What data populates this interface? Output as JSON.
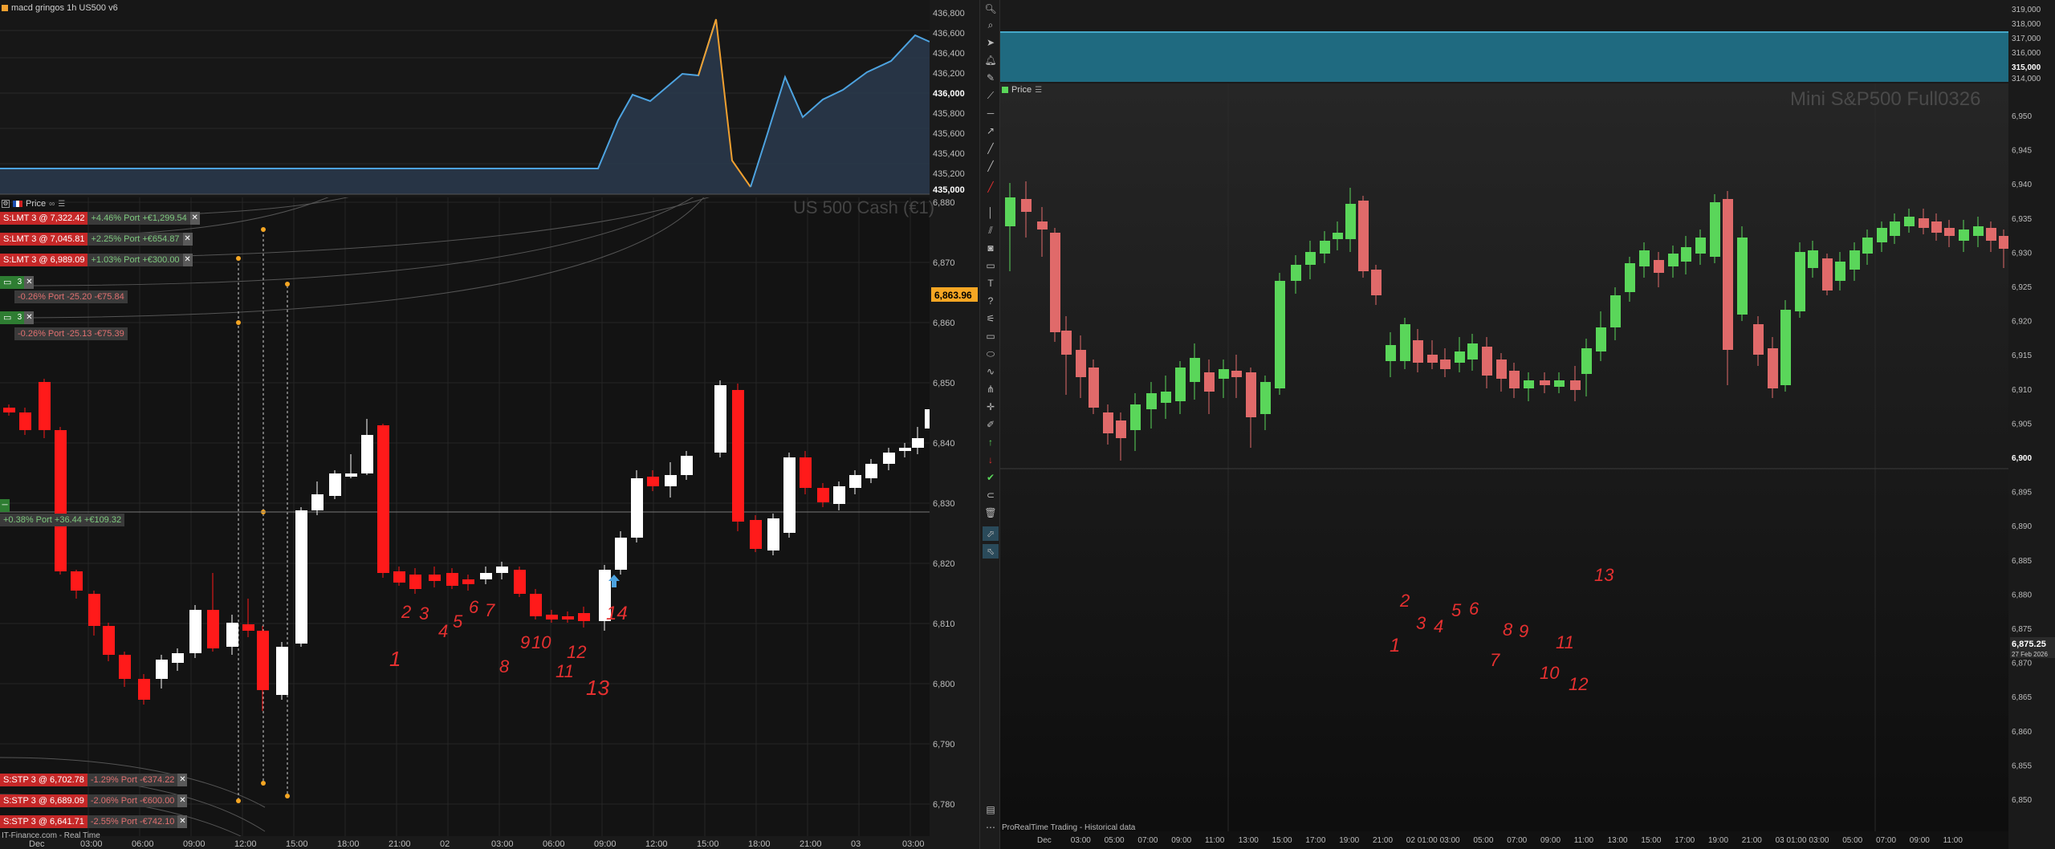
{
  "left_chart": {
    "indicator_title": "macd gringos 1h US500 v6",
    "indicator_ticks": [
      "436,800",
      "436,600",
      "436,400",
      "436,200",
      "436,000",
      "435,800",
      "435,600",
      "435,400",
      "435,200",
      "435,000"
    ],
    "price_label": "Price",
    "watermark": "US 500 Cash (€1)",
    "price_ticks": [
      "6,880",
      "6,870",
      "6,860",
      "6,850",
      "6,840",
      "6,830",
      "6,820",
      "6,810",
      "6,800",
      "6,790",
      "6,780"
    ],
    "current_price": "6,863.96",
    "orders_top": [
      {
        "tag": "S:LMT 3 @ 7,322.42",
        "info": "+4.46% Port  +€1,299.54"
      },
      {
        "tag": "S:LMT 3 @ 7,045.81",
        "info": "+2.25% Port  +€654.87"
      },
      {
        "tag": "S:LMT 3 @ 6,989.09",
        "info": "+1.03% Port  +€300.00"
      }
    ],
    "positions": [
      {
        "info": "-0.26% Port  -25.20  -€75.84"
      },
      {
        "info": "-0.26% Port  -25.13  -€75.39"
      }
    ],
    "position_mid": {
      "info": "+0.38% Port  +36.44  +€109.32"
    },
    "orders_bottom": [
      {
        "tag": "S:STP 3 @ 6,702.78",
        "info": "-1.29% Port  -€374.22"
      },
      {
        "tag": "S:STP 3 @ 6,689.09",
        "info": "-2.06% Port  -€600.00"
      },
      {
        "tag": "S:STP 3 @ 6,641.71",
        "info": "-2.55% Port  -€742.10"
      }
    ],
    "time_labels": [
      "Dec",
      "03:00",
      "06:00",
      "09:00",
      "12:00",
      "15:00",
      "18:00",
      "21:00",
      "02",
      "03:00",
      "06:00",
      "09:00",
      "12:00",
      "15:00",
      "18:00",
      "21:00",
      "03",
      "03:00"
    ],
    "footer": "IT-Finance.com - Real Time",
    "annotations": [
      "1",
      "2",
      "3",
      "4",
      "5",
      "6",
      "7",
      "8",
      "9",
      "10",
      "11",
      "12",
      "13",
      "14"
    ],
    "colors": {
      "bull": "#ffffff",
      "bear": "#ff1a1a",
      "line": "#4da3e0",
      "line_peak": "#f0a030"
    }
  },
  "right_chart": {
    "price_label": "Price",
    "watermark": "Mini S&P500 Full0326",
    "top_ticks": [
      "319,000",
      "318,000",
      "317,000",
      "316,000",
      "315,000",
      "314,000"
    ],
    "price_ticks": [
      "6,950",
      "6,945",
      "6,940",
      "6,935",
      "6,930",
      "6,925",
      "6,920",
      "6,915",
      "6,910",
      "6,905",
      "6,900",
      "6,895",
      "6,890",
      "6,885",
      "6,880",
      "6,875",
      "6,870",
      "6,865",
      "6,860",
      "6,855",
      "6,850"
    ],
    "current_price": "6,875.25",
    "current_date": "27 Feb 2026",
    "time_labels": [
      "Dec",
      "03:00",
      "05:00",
      "07:00",
      "09:00",
      "11:00",
      "13:00",
      "15:00",
      "17:00",
      "19:00",
      "21:00",
      "02 01:00",
      "03:00",
      "05:00",
      "07:00",
      "09:00",
      "11:00",
      "13:00",
      "15:00",
      "17:00",
      "19:00",
      "21:00",
      "03 01:00",
      "03:00",
      "05:00",
      "07:00",
      "09:00",
      "11:00"
    ],
    "footer": "ProRealTime Trading - Historical data",
    "annotations": [
      "1",
      "2",
      "3",
      "4",
      "5",
      "6",
      "7",
      "8",
      "9",
      "10",
      "11",
      "12",
      "13"
    ],
    "colors": {
      "bull": "#5ad65a",
      "bear": "#e06a6a",
      "band": "#1f6a80"
    }
  }
}
